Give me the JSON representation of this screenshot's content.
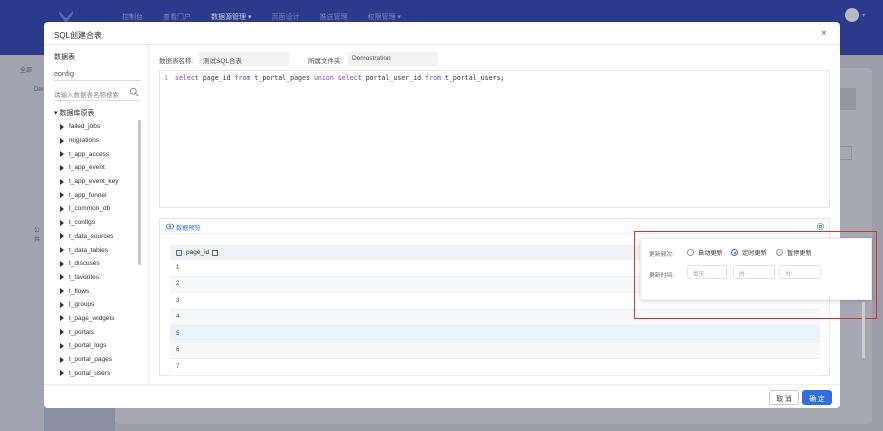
{
  "topnav": {
    "items": [
      "控制台",
      "查看门户",
      "数据源管理 ▾",
      "页面设计",
      "推送管理",
      "权限管理 ▾"
    ],
    "active_index": 2
  },
  "background": {
    "left_items": [
      "全部",
      "Dem",
      "公共"
    ]
  },
  "modal": {
    "title": "SQL创建合表",
    "close_label": "×",
    "left_panel": {
      "title": "数据表",
      "source_select": "config",
      "search_placeholder": "请输入数据表名称搜索",
      "tree_root": "数据库原表",
      "tables": [
        "failed_jobs",
        "migrations",
        "t_app_access",
        "t_app_event",
        "t_app_event_key",
        "t_app_funnel",
        "t_common_db",
        "t_configs",
        "t_data_sources",
        "t_data_tables",
        "t_discuses",
        "t_favorites",
        "t_flows",
        "t_groups",
        "t_page_widgets",
        "t_portals",
        "t_portal_logs",
        "t_portal_pages",
        "t_portal_users"
      ]
    },
    "form": {
      "name_label": "数据表名称:",
      "name_value": "测试SQL合表",
      "folder_label": "所属文件夹:",
      "folder_value": "Demostration"
    },
    "editor": {
      "line_number": "1",
      "tokens": [
        {
          "t": "select",
          "kw": true
        },
        {
          "t": " page_id ",
          "kw": false
        },
        {
          "t": "from",
          "kw": true
        },
        {
          "t": " t_portal_pages ",
          "kw": false
        },
        {
          "t": "union select",
          "kw": true
        },
        {
          "t": " portal_user_id ",
          "kw": false
        },
        {
          "t": "from",
          "kw": true
        },
        {
          "t": " t_portal_users;",
          "kw": false
        }
      ]
    },
    "preview": {
      "title": "数据预览",
      "column": "page_id",
      "rows": [
        "1",
        "2",
        "3",
        "4",
        "5",
        "6",
        "7"
      ],
      "highlight_row": 4
    },
    "update_popover": {
      "freq_label": "更新频次:",
      "options": [
        "自动更新",
        "定时更新",
        "暂停更新"
      ],
      "selected_option": 1,
      "time_label": "更新时间:",
      "selects": [
        "每天",
        "时",
        "分"
      ]
    },
    "footer": {
      "cancel_label": "取 消",
      "ok_label": "确 定"
    }
  },
  "colors": {
    "primary": "#2f6fe0",
    "highlight": "#e03030",
    "topbar": "#2b3a8a"
  }
}
